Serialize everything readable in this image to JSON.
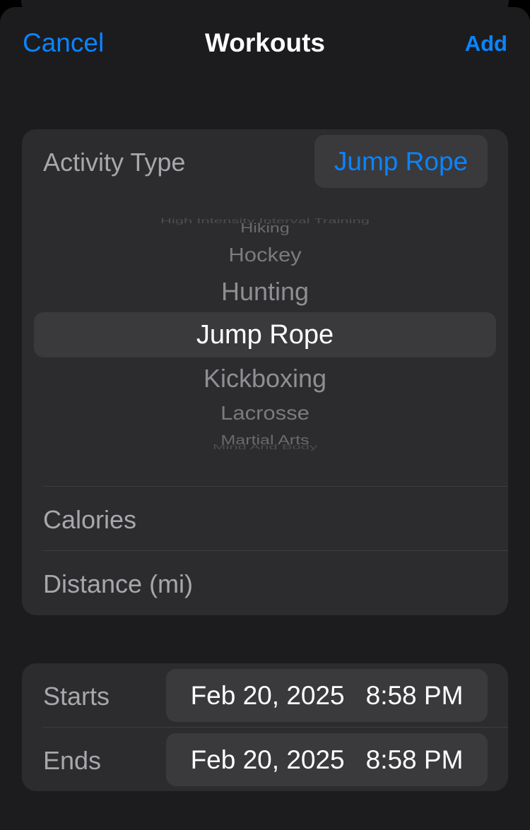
{
  "nav": {
    "cancel": "Cancel",
    "title": "Workouts",
    "add": "Add"
  },
  "activity": {
    "label": "Activity Type",
    "value": "Jump Rope",
    "picker_items": [
      "High Intensity Interval Training",
      "Hiking",
      "Hockey",
      "Hunting",
      "Jump Rope",
      "Kickboxing",
      "Lacrosse",
      "Martial Arts",
      "Mind And Body"
    ],
    "selected_index": 4
  },
  "fields": {
    "calories": "Calories",
    "distance": "Distance (mi)"
  },
  "times": {
    "starts": {
      "label": "Starts",
      "date": "Feb 20, 2025",
      "time": "8:58 PM"
    },
    "ends": {
      "label": "Ends",
      "date": "Feb 20, 2025",
      "time": "8:58 PM"
    }
  },
  "colors": {
    "accent": "#0a84ff",
    "background": "#1c1c1e",
    "card": "#2c2c2e"
  }
}
